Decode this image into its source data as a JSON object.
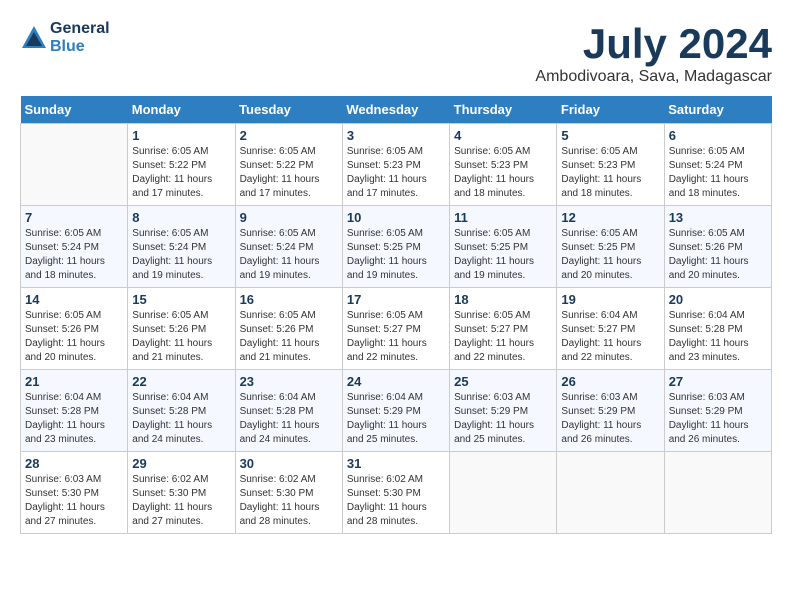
{
  "header": {
    "logo_line1": "General",
    "logo_line2": "Blue",
    "month_title": "July 2024",
    "location": "Ambodivoara, Sava, Madagascar"
  },
  "weekdays": [
    "Sunday",
    "Monday",
    "Tuesday",
    "Wednesday",
    "Thursday",
    "Friday",
    "Saturday"
  ],
  "weeks": [
    [
      {
        "day": "",
        "empty": true
      },
      {
        "day": "1",
        "sunrise": "Sunrise: 6:05 AM",
        "sunset": "Sunset: 5:22 PM",
        "daylight": "Daylight: 11 hours and 17 minutes."
      },
      {
        "day": "2",
        "sunrise": "Sunrise: 6:05 AM",
        "sunset": "Sunset: 5:22 PM",
        "daylight": "Daylight: 11 hours and 17 minutes."
      },
      {
        "day": "3",
        "sunrise": "Sunrise: 6:05 AM",
        "sunset": "Sunset: 5:23 PM",
        "daylight": "Daylight: 11 hours and 17 minutes."
      },
      {
        "day": "4",
        "sunrise": "Sunrise: 6:05 AM",
        "sunset": "Sunset: 5:23 PM",
        "daylight": "Daylight: 11 hours and 18 minutes."
      },
      {
        "day": "5",
        "sunrise": "Sunrise: 6:05 AM",
        "sunset": "Sunset: 5:23 PM",
        "daylight": "Daylight: 11 hours and 18 minutes."
      },
      {
        "day": "6",
        "sunrise": "Sunrise: 6:05 AM",
        "sunset": "Sunset: 5:24 PM",
        "daylight": "Daylight: 11 hours and 18 minutes."
      }
    ],
    [
      {
        "day": "7",
        "sunrise": "Sunrise: 6:05 AM",
        "sunset": "Sunset: 5:24 PM",
        "daylight": "Daylight: 11 hours and 18 minutes."
      },
      {
        "day": "8",
        "sunrise": "Sunrise: 6:05 AM",
        "sunset": "Sunset: 5:24 PM",
        "daylight": "Daylight: 11 hours and 19 minutes."
      },
      {
        "day": "9",
        "sunrise": "Sunrise: 6:05 AM",
        "sunset": "Sunset: 5:24 PM",
        "daylight": "Daylight: 11 hours and 19 minutes."
      },
      {
        "day": "10",
        "sunrise": "Sunrise: 6:05 AM",
        "sunset": "Sunset: 5:25 PM",
        "daylight": "Daylight: 11 hours and 19 minutes."
      },
      {
        "day": "11",
        "sunrise": "Sunrise: 6:05 AM",
        "sunset": "Sunset: 5:25 PM",
        "daylight": "Daylight: 11 hours and 19 minutes."
      },
      {
        "day": "12",
        "sunrise": "Sunrise: 6:05 AM",
        "sunset": "Sunset: 5:25 PM",
        "daylight": "Daylight: 11 hours and 20 minutes."
      },
      {
        "day": "13",
        "sunrise": "Sunrise: 6:05 AM",
        "sunset": "Sunset: 5:26 PM",
        "daylight": "Daylight: 11 hours and 20 minutes."
      }
    ],
    [
      {
        "day": "14",
        "sunrise": "Sunrise: 6:05 AM",
        "sunset": "Sunset: 5:26 PM",
        "daylight": "Daylight: 11 hours and 20 minutes."
      },
      {
        "day": "15",
        "sunrise": "Sunrise: 6:05 AM",
        "sunset": "Sunset: 5:26 PM",
        "daylight": "Daylight: 11 hours and 21 minutes."
      },
      {
        "day": "16",
        "sunrise": "Sunrise: 6:05 AM",
        "sunset": "Sunset: 5:26 PM",
        "daylight": "Daylight: 11 hours and 21 minutes."
      },
      {
        "day": "17",
        "sunrise": "Sunrise: 6:05 AM",
        "sunset": "Sunset: 5:27 PM",
        "daylight": "Daylight: 11 hours and 22 minutes."
      },
      {
        "day": "18",
        "sunrise": "Sunrise: 6:05 AM",
        "sunset": "Sunset: 5:27 PM",
        "daylight": "Daylight: 11 hours and 22 minutes."
      },
      {
        "day": "19",
        "sunrise": "Sunrise: 6:04 AM",
        "sunset": "Sunset: 5:27 PM",
        "daylight": "Daylight: 11 hours and 22 minutes."
      },
      {
        "day": "20",
        "sunrise": "Sunrise: 6:04 AM",
        "sunset": "Sunset: 5:28 PM",
        "daylight": "Daylight: 11 hours and 23 minutes."
      }
    ],
    [
      {
        "day": "21",
        "sunrise": "Sunrise: 6:04 AM",
        "sunset": "Sunset: 5:28 PM",
        "daylight": "Daylight: 11 hours and 23 minutes."
      },
      {
        "day": "22",
        "sunrise": "Sunrise: 6:04 AM",
        "sunset": "Sunset: 5:28 PM",
        "daylight": "Daylight: 11 hours and 24 minutes."
      },
      {
        "day": "23",
        "sunrise": "Sunrise: 6:04 AM",
        "sunset": "Sunset: 5:28 PM",
        "daylight": "Daylight: 11 hours and 24 minutes."
      },
      {
        "day": "24",
        "sunrise": "Sunrise: 6:04 AM",
        "sunset": "Sunset: 5:29 PM",
        "daylight": "Daylight: 11 hours and 25 minutes."
      },
      {
        "day": "25",
        "sunrise": "Sunrise: 6:03 AM",
        "sunset": "Sunset: 5:29 PM",
        "daylight": "Daylight: 11 hours and 25 minutes."
      },
      {
        "day": "26",
        "sunrise": "Sunrise: 6:03 AM",
        "sunset": "Sunset: 5:29 PM",
        "daylight": "Daylight: 11 hours and 26 minutes."
      },
      {
        "day": "27",
        "sunrise": "Sunrise: 6:03 AM",
        "sunset": "Sunset: 5:29 PM",
        "daylight": "Daylight: 11 hours and 26 minutes."
      }
    ],
    [
      {
        "day": "28",
        "sunrise": "Sunrise: 6:03 AM",
        "sunset": "Sunset: 5:30 PM",
        "daylight": "Daylight: 11 hours and 27 minutes."
      },
      {
        "day": "29",
        "sunrise": "Sunrise: 6:02 AM",
        "sunset": "Sunset: 5:30 PM",
        "daylight": "Daylight: 11 hours and 27 minutes."
      },
      {
        "day": "30",
        "sunrise": "Sunrise: 6:02 AM",
        "sunset": "Sunset: 5:30 PM",
        "daylight": "Daylight: 11 hours and 28 minutes."
      },
      {
        "day": "31",
        "sunrise": "Sunrise: 6:02 AM",
        "sunset": "Sunset: 5:30 PM",
        "daylight": "Daylight: 11 hours and 28 minutes."
      },
      {
        "day": "",
        "empty": true
      },
      {
        "day": "",
        "empty": true
      },
      {
        "day": "",
        "empty": true
      }
    ]
  ]
}
